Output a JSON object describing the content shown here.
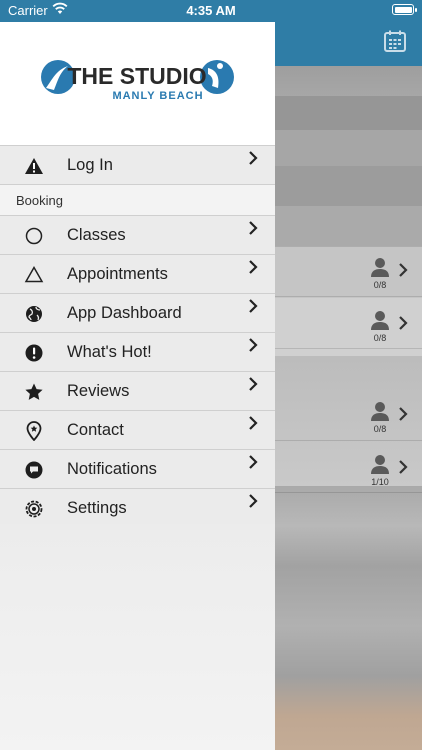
{
  "status_bar": {
    "carrier": "Carrier",
    "time": "4:35 AM"
  },
  "logo": {
    "name_line1": "THE STUDIO",
    "name_line2": "MANLY BEACH"
  },
  "menu": {
    "login": {
      "label": "Log In",
      "icon": "warning-icon"
    },
    "section_label": "Booking",
    "items": [
      {
        "label": "Classes",
        "icon": "circle-icon"
      },
      {
        "label": "Appointments",
        "icon": "triangle-icon"
      },
      {
        "label": "App Dashboard",
        "icon": "globe-icon"
      },
      {
        "label": "What's Hot!",
        "icon": "exclamation-icon"
      },
      {
        "label": "Reviews",
        "icon": "star-icon"
      },
      {
        "label": "Contact",
        "icon": "location-pin-icon"
      },
      {
        "label": "Notifications",
        "icon": "chat-bubble-icon"
      },
      {
        "label": "Settings",
        "icon": "gear-icon"
      }
    ]
  },
  "background_list": {
    "slots": [
      {
        "count": "0/8"
      },
      {
        "count": "0/8"
      },
      {
        "count": "0/8"
      },
      {
        "count": "1/10"
      }
    ]
  },
  "colors": {
    "header_blue": "#2f7da6",
    "logo_blue": "#2a7ab0",
    "logo_dark": "#222222"
  }
}
